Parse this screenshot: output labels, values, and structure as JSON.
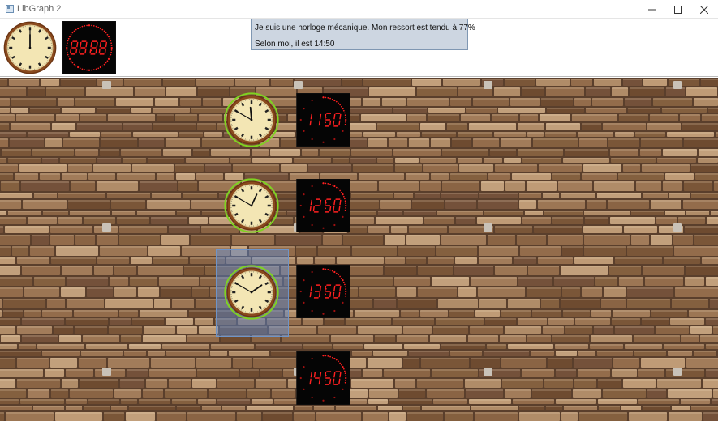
{
  "window": {
    "title": "LibGraph 2",
    "minimize_icon": "minimize-icon",
    "maximize_icon": "maximize-icon",
    "close_icon": "close-icon"
  },
  "toolbar": {
    "analog_clock_icon": "analog-clock-icon",
    "digital_clock_display": "88:88"
  },
  "message": {
    "line1": "Je suis une horloge mécanique. Mon ressort est tendu à 77%",
    "line2": "Selon moi, il est 14:50",
    "spring_tension_percent": 77
  },
  "clocks": {
    "analog": [
      {
        "id": "analog-clock-1",
        "hour": 11,
        "minute": 50,
        "selected": false
      },
      {
        "id": "analog-clock-2",
        "hour": 12,
        "minute": 50,
        "selected": false
      },
      {
        "id": "analog-clock-3",
        "hour": 13,
        "minute": 50,
        "selected": true
      }
    ],
    "digital": [
      {
        "id": "digital-clock-1",
        "display": "11:50",
        "seconds_progress": 0.3
      },
      {
        "id": "digital-clock-2",
        "display": "12:50",
        "seconds_progress": 0.3
      },
      {
        "id": "digital-clock-3",
        "display": "13:50",
        "seconds_progress": 0.3
      },
      {
        "id": "digital-clock-4",
        "display": "14:50",
        "seconds_progress": 0.3
      }
    ]
  },
  "colors": {
    "ring_green": "#7fd321",
    "digital_red": "#ff2020",
    "wall_mortar": "#5a3f2c",
    "selection_blue": "#5a8cd7"
  }
}
